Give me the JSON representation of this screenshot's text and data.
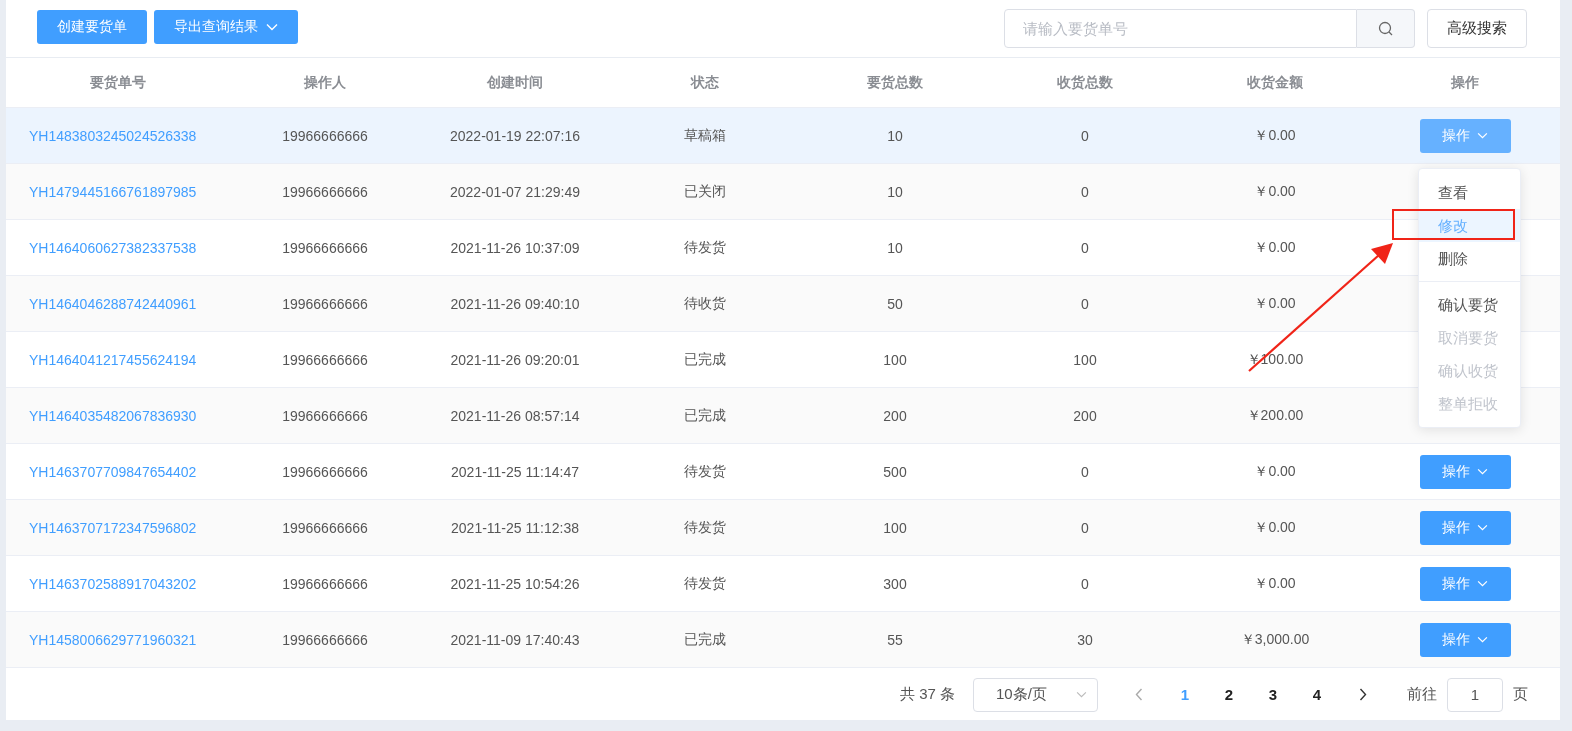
{
  "toolbar": {
    "buttons": [
      {
        "label": "创建要货单",
        "caret": false
      },
      {
        "label": "导出查询结果",
        "caret": true
      }
    ],
    "search": {
      "placeholder": "请输入要货单号"
    },
    "advanced_button": "高级搜索"
  },
  "table": {
    "columns": [
      "要货单号",
      "操作人",
      "创建时间",
      "状态",
      "要货总数",
      "收货总数",
      "收货金额",
      "操作"
    ],
    "rows": [
      {
        "order_no": "YH1483803245024526338",
        "operator": "19966666666",
        "created": "2022-01-19 22:07:16",
        "status": "草稿箱",
        "requested": "10",
        "received": "0",
        "amount": "￥0.00",
        "action": "操作",
        "highlighted": true
      },
      {
        "order_no": "YH1479445166761897985",
        "operator": "19966666666",
        "created": "2022-01-07 21:29:49",
        "status": "已关闭",
        "requested": "10",
        "received": "0",
        "amount": "￥0.00",
        "highlighted": false
      },
      {
        "order_no": "YH1464060627382337538",
        "operator": "19966666666",
        "created": "2021-11-26 10:37:09",
        "status": "待发货",
        "requested": "10",
        "received": "0",
        "amount": "￥0.00",
        "highlighted": false
      },
      {
        "order_no": "YH1464046288742440961",
        "operator": "19966666666",
        "created": "2021-11-26 09:40:10",
        "status": "待收货",
        "requested": "50",
        "received": "0",
        "amount": "￥0.00",
        "highlighted": false
      },
      {
        "order_no": "YH1464041217455624194",
        "operator": "19966666666",
        "created": "2021-11-26 09:20:01",
        "status": "已完成",
        "requested": "100",
        "received": "100",
        "amount": "￥100.00",
        "highlighted": false
      },
      {
        "order_no": "YH1464035482067836930",
        "operator": "19966666666",
        "created": "2021-11-26 08:57:14",
        "status": "已完成",
        "requested": "200",
        "received": "200",
        "amount": "￥200.00",
        "highlighted": false
      },
      {
        "order_no": "YH1463707709847654402",
        "operator": "19966666666",
        "created": "2021-11-25 11:14:47",
        "status": "待发货",
        "requested": "500",
        "received": "0",
        "amount": "￥0.00",
        "action": "操作",
        "highlighted": false
      },
      {
        "order_no": "YH1463707172347596802",
        "operator": "19966666666",
        "created": "2021-11-25 11:12:38",
        "status": "待发货",
        "requested": "100",
        "received": "0",
        "amount": "￥0.00",
        "action": "操作",
        "highlighted": false
      },
      {
        "order_no": "YH1463702588917043202",
        "operator": "19966666666",
        "created": "2021-11-25 10:54:26",
        "status": "待发货",
        "requested": "300",
        "received": "0",
        "amount": "￥0.00",
        "action": "操作",
        "highlighted": false
      },
      {
        "order_no": "YH1458006629771960321",
        "operator": "19966666666",
        "created": "2021-11-09 17:40:43",
        "status": "已完成",
        "requested": "55",
        "received": "30",
        "amount": "￥3,000.00",
        "action": "操作",
        "highlighted": false
      }
    ]
  },
  "action_menu": {
    "items": [
      {
        "label": "查看",
        "disabled": false,
        "hovered": false,
        "divided": false,
        "annotated": false
      },
      {
        "label": "修改",
        "disabled": false,
        "hovered": true,
        "divided": false,
        "annotated": true
      },
      {
        "label": "删除",
        "disabled": false,
        "hovered": false,
        "divided": false,
        "annotated": false
      },
      {
        "label": "确认要货",
        "disabled": false,
        "hovered": false,
        "divided": true,
        "annotated": false
      },
      {
        "label": "取消要货",
        "disabled": true,
        "hovered": false,
        "divided": false,
        "annotated": false
      },
      {
        "label": "确认收货",
        "disabled": true,
        "hovered": false,
        "divided": false,
        "annotated": false
      },
      {
        "label": "整单拒收",
        "disabled": true,
        "hovered": false,
        "divided": false,
        "annotated": false
      }
    ]
  },
  "pagination": {
    "total": "共 37 条",
    "page_size": "10条/页",
    "pages": [
      {
        "label": "1",
        "selected": true
      },
      {
        "label": "2",
        "selected": false
      },
      {
        "label": "3",
        "selected": false
      },
      {
        "label": "4",
        "selected": false
      }
    ],
    "goto_label": "前往",
    "goto_value": "1",
    "goto_suffix": "页"
  }
}
